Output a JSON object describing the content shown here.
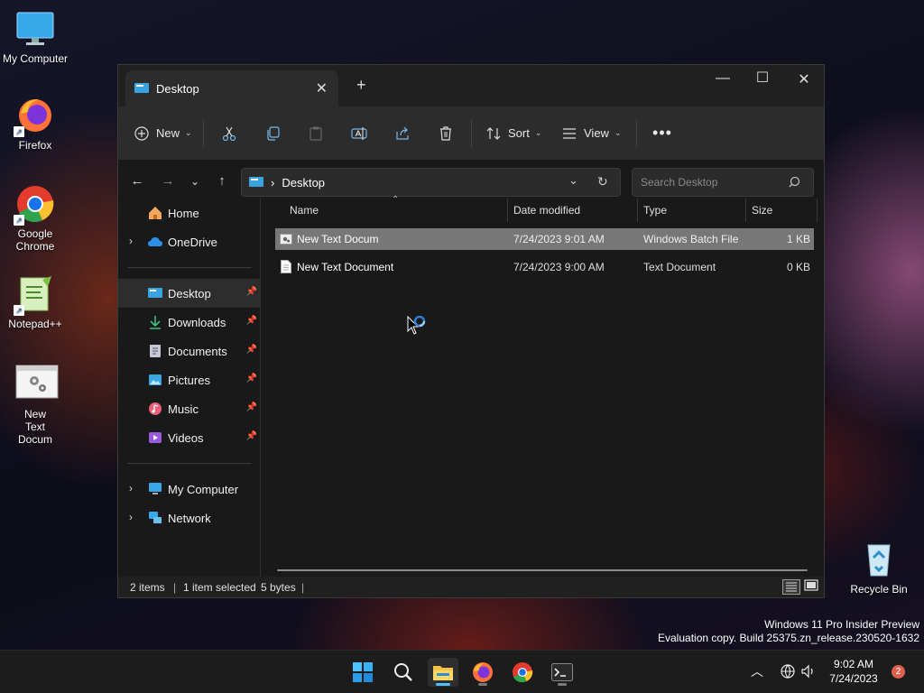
{
  "desktop": {
    "icons": [
      {
        "label": "My Computer"
      },
      {
        "label": "Firefox"
      },
      {
        "label": "Google Chrome"
      },
      {
        "label": "Notepad++"
      },
      {
        "label": "New Text Docum"
      },
      {
        "label": "Recycle Bin"
      }
    ]
  },
  "window": {
    "tab_title": "Desktop",
    "toolbar": {
      "new_label": "New",
      "sort_label": "Sort",
      "view_label": "View"
    },
    "address": {
      "path": "Desktop"
    },
    "search": {
      "placeholder": "Search Desktop"
    },
    "sidebar": {
      "items": [
        {
          "label": "Home"
        },
        {
          "label": "OneDrive"
        },
        {
          "label": "Desktop"
        },
        {
          "label": "Downloads"
        },
        {
          "label": "Documents"
        },
        {
          "label": "Pictures"
        },
        {
          "label": "Music"
        },
        {
          "label": "Videos"
        },
        {
          "label": "My Computer"
        },
        {
          "label": "Network"
        }
      ]
    },
    "columns": {
      "name": "Name",
      "date": "Date modified",
      "type": "Type",
      "size": "Size"
    },
    "files": [
      {
        "name": "New Text Docum",
        "date": "7/24/2023 9:01 AM",
        "type": "Windows Batch File",
        "size": "1 KB"
      },
      {
        "name": "New Text Document",
        "date": "7/24/2023 9:00 AM",
        "type": "Text Document",
        "size": "0 KB"
      }
    ],
    "status": {
      "items": "2 items",
      "selected": "1 item selected",
      "bytes": "5 bytes"
    }
  },
  "watermark": {
    "line1": "Windows 11 Pro Insider Preview",
    "line2": "Evaluation copy. Build 25375.zn_release.230520-1632"
  },
  "taskbar": {
    "time": "9:02 AM",
    "date": "7/24/2023",
    "notification_count": "2"
  },
  "colors": {
    "accent": "#4cc2ff",
    "selection": "#777777",
    "window_bg": "#191919",
    "toolbar_bg": "#2c2c2c"
  }
}
